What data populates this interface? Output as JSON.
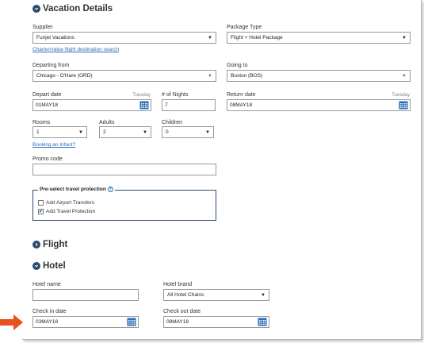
{
  "vacation": {
    "title": "Vacation Details",
    "supplier": {
      "label": "Supplier",
      "value": "Funjet Vacations"
    },
    "charter_link": "Charter/value flight destination search",
    "package": {
      "label": "Package Type",
      "value": "Flight + Hotel Package"
    },
    "departing": {
      "label": "Departing from",
      "value": "Chicago - O'Hare (ORD)"
    },
    "going": {
      "label": "Going to",
      "value": "Boston (BOS)"
    },
    "depart_date": {
      "label": "Depart date",
      "day": "Tuesday",
      "value": "01MAY18"
    },
    "nights": {
      "label": "# of Nights",
      "value": "7"
    },
    "return_date": {
      "label": "Return date",
      "day": "Tuesday",
      "value": "08MAY18"
    },
    "rooms": {
      "label": "Rooms",
      "value": "1"
    },
    "adults": {
      "label": "Adults",
      "value": "2"
    },
    "children": {
      "label": "Children",
      "value": "0"
    },
    "infant_link": "Booking an Infant?",
    "promo": {
      "label": "Promo code",
      "value": ""
    },
    "protection": {
      "legend": "Pre-select travel protection",
      "airport_transfers": {
        "label": "Add Airport Transfers",
        "checked": false
      },
      "travel_protection": {
        "label": "Add Travel Protection",
        "checked": true
      }
    }
  },
  "flight": {
    "title": "Flight"
  },
  "hotel": {
    "title": "Hotel",
    "name": {
      "label": "Hotel name",
      "value": ""
    },
    "brand": {
      "label": "Hotel brand",
      "value": "All Hotel Chains"
    },
    "check_in": {
      "label": "Check in date",
      "value": "03MAY18"
    },
    "check_out": {
      "label": "Check out date",
      "value": "08MAY18"
    }
  },
  "icons": {
    "section_chevron_down": "chevron-down-icon",
    "section_chevron_right": "chevron-right-icon",
    "calendar": "calendar-icon",
    "help": "help-icon",
    "pointer_arrow": "arrow-right-icon"
  },
  "colors": {
    "section_icon": "#2e4a6b",
    "link": "#2a6fb8",
    "calendar": "#2a6fb8",
    "pointer_arrow": "#e8501e"
  }
}
